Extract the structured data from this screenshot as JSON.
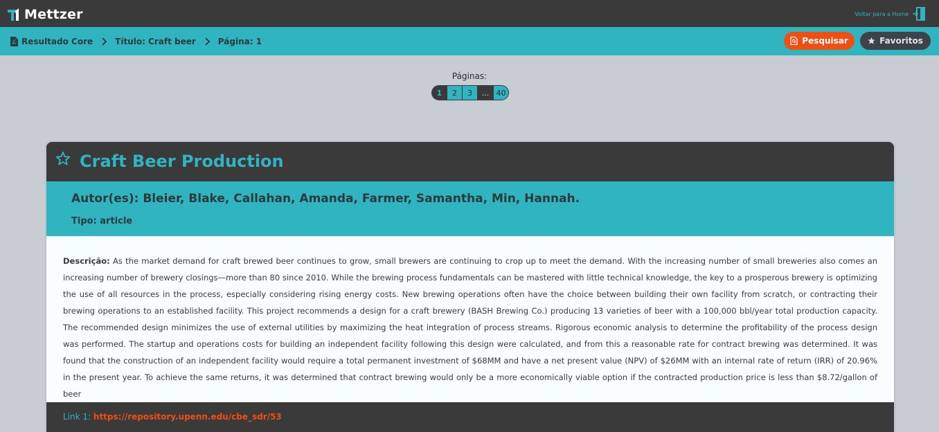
{
  "header": {
    "logo_text": "Mettzer",
    "home_link": "Voltar para a Home"
  },
  "breadcrumb": {
    "items": [
      {
        "label": "Resultado Core"
      },
      {
        "label": "Título: Craft beer"
      },
      {
        "label": "Página: 1"
      }
    ]
  },
  "actions": {
    "search_label": "Pesquisar",
    "favorites_label": "Favoritos"
  },
  "pagination": {
    "label": "Páginas:",
    "pages": [
      "1",
      "2",
      "3",
      "...",
      "40"
    ],
    "current": "1"
  },
  "record": {
    "title": "Craft Beer Production",
    "authors": "Autor(es): Bleier, Blake, Callahan, Amanda, Farmer, Samantha, Min, Hannah.",
    "type": "Tipo: article",
    "description_label": "Descrição:",
    "description": "As the market demand for craft brewed beer continues to grow, small brewers are continuing to crop up to meet the demand. With the increasing number of small breweries also comes an increasing number of brewery closings—more than 80 since 2010. While the brewing process fundamentals can be mastered with little technical knowledge, the key to a prosperous brewery is optimizing the use of all resources in the process, especially considering rising energy costs. New brewing operations often have the choice between building their own facility from scratch, or contracting their brewing operations to an established facility. This project recommends a design for a craft brewery (BASH Brewing Co.) producing 13 varieties of beer with a 100,000 bbl/year total production capacity. The recommended design minimizes the use of external utilities by maximizing the heat integration of process streams. Rigorous economic analysis to determine the profitability of the process design was performed. The startup and operations costs for building an independent facility following this design were calculated, and from this a reasonable rate for contract brewing was determined. It was found that the construction of an independent facility would require a total permanent investment of $68MM and have a net present value (NPV) of $26MM with an internal rate of return (IRR) of 20.96% in the present year. To achieve the same returns, it was determined that contract brewing would only be a more economically viable option if the contracted production price is less than $8.72/gallon of beer",
    "link_label": "Link 1:",
    "link_url": "https://repository.upenn.edu/cbe_sdr/53"
  },
  "colors": {
    "accent": "#2fb4c0",
    "dark": "#3a3a3a",
    "orange": "#f04e12",
    "background": "#c8cdd3"
  },
  "icons": [
    "logo-icon",
    "door-icon",
    "pdf-icon",
    "chevron-right-icon",
    "search-doc-icon",
    "star-icon",
    "star-outline-icon"
  ]
}
